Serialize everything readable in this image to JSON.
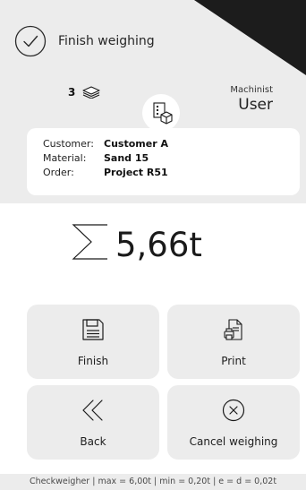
{
  "header": {
    "title": "Finish weighing"
  },
  "loads": {
    "count": "3"
  },
  "machinist": {
    "label": "Machinist",
    "value": "User"
  },
  "info": {
    "rows": [
      {
        "key": "Customer:",
        "value": "Customer A"
      },
      {
        "key": "Material:",
        "value": "Sand 15"
      },
      {
        "key": "Order:",
        "value": "Project R51"
      }
    ]
  },
  "total": {
    "value": "5,66t"
  },
  "buttons": {
    "finish": "Finish",
    "print": "Print",
    "back": "Back",
    "cancel": "Cancel weighing"
  },
  "footer": {
    "text": "Checkweigher | max = 6,00t | min = 0,20t | e = d = 0,02t"
  },
  "colors": {
    "background": "#ececec",
    "panel": "#ffffff",
    "wedge": "#1c1c1c",
    "text": "#1d1d1d"
  },
  "icons": [
    "check-circle-icon",
    "layers-icon",
    "boxes-icon",
    "sigma-icon",
    "save-icon",
    "print-icon",
    "chevrons-left-icon",
    "cancel-circle-icon"
  ]
}
